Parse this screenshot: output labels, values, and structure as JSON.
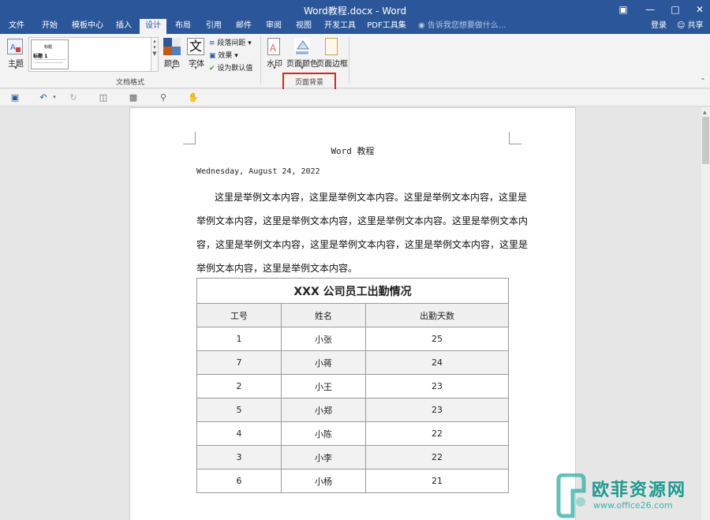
{
  "window": {
    "title": "Word教程.docx - Word",
    "controls": [
      "ribbon-display-icon",
      "minimize-icon",
      "restore-icon",
      "close-icon"
    ]
  },
  "tabs": [
    {
      "label": "文件"
    },
    {
      "label": "开始"
    },
    {
      "label": "模板中心"
    },
    {
      "label": "插入"
    },
    {
      "label": "设计",
      "active": true
    },
    {
      "label": "布局"
    },
    {
      "label": "引用"
    },
    {
      "label": "邮件"
    },
    {
      "label": "审阅"
    },
    {
      "label": "视图"
    },
    {
      "label": "开发工具"
    },
    {
      "label": "PDF工具集"
    }
  ],
  "tell_me": "告诉我您想要做什么...",
  "login": "登录",
  "share": "共享",
  "ribbon": {
    "theme_label": "主题",
    "gallery_title": "标题",
    "gallery_heading": "标题 1",
    "colors_label": "颜色",
    "fonts_label": "字体",
    "font_glyph": "文",
    "paragraph_spacing": "段落间距",
    "effects": "效果",
    "set_default": "设为默认值",
    "group_doc_format": "文档格式",
    "watermark_label": "水印",
    "page_color_label": "页面颜色",
    "page_border_label": "页面边框",
    "group_page_background": "页面背景"
  },
  "colors": {
    "brand": "#2b579a",
    "highlight_box": "#e02020"
  },
  "document": {
    "header": "Word 教程",
    "date": "Wednesday, August 24, 2022",
    "lines": [
      "这里是举例文本内容，这里是举例文本内容。这里是举例文本内容，这里是",
      "举例文本内容，这里是举例文本内容，这里是举例文本内容。这里是举例文本内",
      "容，这里是举例文本内容，这里是举例文本内容，这里是举例文本内容，这里是",
      "举例文本内容，这里是举例文本内容。"
    ],
    "table": {
      "caption": "XXX 公司员工出勤情况",
      "headers": [
        "工号",
        "姓名",
        "出勤天数"
      ],
      "rows": [
        [
          "1",
          "小张",
          "25"
        ],
        [
          "7",
          "小蒋",
          "24"
        ],
        [
          "2",
          "小王",
          "23"
        ],
        [
          "5",
          "小郑",
          "23"
        ],
        [
          "4",
          "小陈",
          "22"
        ],
        [
          "3",
          "小李",
          "22"
        ],
        [
          "6",
          "小杨",
          "21"
        ]
      ]
    }
  },
  "watermark": {
    "text": "欧菲资源网",
    "url": "www.office26.com"
  }
}
